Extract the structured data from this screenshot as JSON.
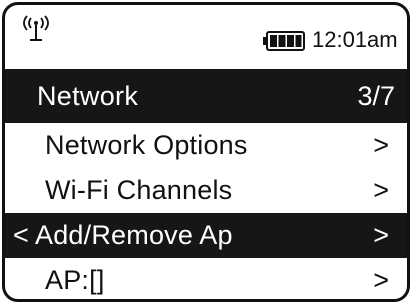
{
  "status_bar": {
    "signal_icon": "wifi-signal-icon",
    "battery_icon": "battery-full-icon",
    "time": "12:01am"
  },
  "header": {
    "title": "Network",
    "page_indicator": "3/7"
  },
  "menu": {
    "items": [
      {
        "label": "Network Options",
        "arrow": ">",
        "selected": false
      },
      {
        "label": "Wi-Fi Channels",
        "arrow": ">",
        "selected": false
      },
      {
        "label": "Add/Remove Ap",
        "arrow": ">",
        "back": "<",
        "selected": true
      },
      {
        "label": "AP:[]",
        "arrow": ">",
        "selected": false
      }
    ]
  },
  "colors": {
    "background": "#ffffff",
    "foreground": "#111111",
    "highlight_bg": "#161616",
    "highlight_fg": "#ffffff"
  }
}
